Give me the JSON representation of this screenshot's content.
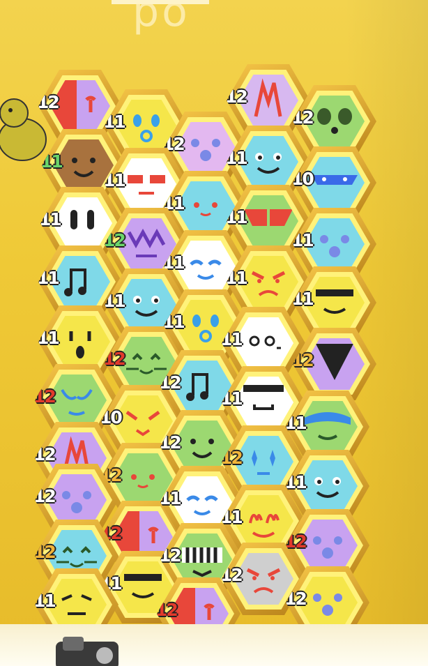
{
  "scene": {
    "sign_text": "po",
    "wall_color": "#efc936",
    "slot_frame_color": "#d9a22c"
  },
  "hive": {
    "cells": [
      {
        "level": "12",
        "bg": "#c8a2f0",
        "face": "split_red",
        "lvlColor": "white"
      },
      {
        "level": "11",
        "bg": "#f5e64a",
        "face": "wow",
        "lvlColor": "white"
      },
      {
        "level": "12",
        "bg": "#e3b8f0",
        "face": "dots",
        "lvlColor": "white"
      },
      {
        "level": "12",
        "bg": "#d7b8f0",
        "face": "flame",
        "lvlColor": "white"
      },
      {
        "level": "12",
        "bg": "#9cd871",
        "face": "panda",
        "lvlColor": "white"
      },
      {
        "level": "11",
        "bg": "#a8723e",
        "face": "smile",
        "lvlColor": "green"
      },
      {
        "level": "11",
        "bg": "#ffffff",
        "face": "shades",
        "lvlColor": "white"
      },
      {
        "level": "11",
        "bg": "#7fd9e8",
        "face": "cheeks",
        "lvlColor": "white"
      },
      {
        "level": "11",
        "bg": "#7fd9e8",
        "face": "happy",
        "lvlColor": "white"
      },
      {
        "level": "10",
        "bg": "#7fd9e8",
        "face": "mask",
        "lvlColor": "white"
      },
      {
        "level": "11",
        "bg": "#ffffff",
        "face": "eyes",
        "lvlColor": "white"
      },
      {
        "level": "12",
        "bg": "#c8a2f0",
        "face": "fuzzy",
        "lvlColor": "green"
      },
      {
        "level": "11",
        "bg": "#ffffff",
        "face": "calm",
        "lvlColor": "white"
      },
      {
        "level": "11",
        "bg": "#9cd871",
        "face": "hero",
        "lvlColor": "white"
      },
      {
        "level": "11",
        "bg": "#7fd9e8",
        "face": "dots",
        "lvlColor": "white"
      },
      {
        "level": "11",
        "bg": "#7fd9e8",
        "face": "music",
        "lvlColor": "white"
      },
      {
        "level": "11",
        "bg": "#7fd9e8",
        "face": "happy",
        "lvlColor": "white"
      },
      {
        "level": "11",
        "bg": "#f5e64a",
        "face": "angry",
        "lvlColor": "white"
      },
      {
        "level": "11",
        "bg": "#f5e64a",
        "face": "grin",
        "lvlColor": "white"
      },
      {
        "level": "11",
        "bg": "#f5e64a",
        "face": "scared",
        "lvlColor": "white"
      },
      {
        "level": "12",
        "bg": "#9cd871",
        "face": "cat",
        "lvlColor": "red"
      },
      {
        "level": "11",
        "bg": "#f5e64a",
        "face": "wow",
        "lvlColor": "white"
      },
      {
        "level": "11",
        "bg": "#ffffff",
        "face": "doodle",
        "lvlColor": "white"
      },
      {
        "level": "12",
        "bg": "#c8a2f0",
        "face": "vulture",
        "lvlColor": "gold"
      },
      {
        "level": "12",
        "bg": "#9cd871",
        "face": "alien",
        "lvlColor": "red"
      },
      {
        "level": "10",
        "bg": "#f5e64a",
        "face": "fox",
        "lvlColor": "white"
      },
      {
        "level": "12",
        "bg": "#7fd9e8",
        "face": "music",
        "lvlColor": "white"
      },
      {
        "level": "11",
        "bg": "#ffffff",
        "face": "bowler",
        "lvlColor": "white"
      },
      {
        "level": "11",
        "bg": "#9cd871",
        "face": "frog",
        "lvlColor": "white"
      },
      {
        "level": "12",
        "bg": "#c8a2f0",
        "face": "flame",
        "lvlColor": "white"
      },
      {
        "level": "12",
        "bg": "#9cd871",
        "face": "cheeks",
        "lvlColor": "gold"
      },
      {
        "level": "12",
        "bg": "#9cd871",
        "face": "smile",
        "lvlColor": "white"
      },
      {
        "level": "12",
        "bg": "#7fd9e8",
        "face": "sparkle",
        "lvlColor": "gold"
      },
      {
        "level": "11",
        "bg": "#7fd9e8",
        "face": "happy",
        "lvlColor": "white"
      },
      {
        "level": "12",
        "bg": "#c8a2f0",
        "face": "dots",
        "lvlColor": "white"
      },
      {
        "level": "12",
        "bg": "#c8a2f0",
        "face": "split_red",
        "lvlColor": "red"
      },
      {
        "level": "11",
        "bg": "#ffffff",
        "face": "calm",
        "lvlColor": "white"
      },
      {
        "level": "11",
        "bg": "#f5e64a",
        "face": "fire",
        "lvlColor": "white"
      },
      {
        "level": "12",
        "bg": "#c8a2f0",
        "face": "dots",
        "lvlColor": "red"
      },
      {
        "level": "12",
        "bg": "#7fd9e8",
        "face": "cat",
        "lvlColor": "gold"
      },
      {
        "level": "11",
        "bg": "#f5e64a",
        "face": "grin",
        "lvlColor": "white"
      },
      {
        "level": "12",
        "bg": "#9cd871",
        "face": "tiger",
        "lvlColor": "white"
      },
      {
        "level": "12",
        "bg": "#cfcfcf",
        "face": "angry",
        "lvlColor": "white"
      },
      {
        "level": "12",
        "bg": "#f5e64a",
        "face": "dots",
        "lvlColor": "white"
      },
      {
        "level": "11",
        "bg": "#f5e64a",
        "face": "sad",
        "lvlColor": "white"
      },
      {
        "level": "12",
        "bg": "#c8a2f0",
        "face": "split_red",
        "lvlColor": "red"
      }
    ]
  }
}
